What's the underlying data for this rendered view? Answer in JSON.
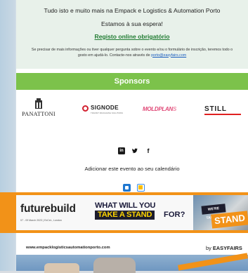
{
  "email": {
    "line1": "Tudo isto e muito mais na Empack e Logistics & Automation Porto",
    "line2": "Estamos à sua espera!",
    "register_link": "Registo online obrigatório",
    "contact_text": "Se precisar de mais informações ou tiver qualquer pergunta sobre o evento e/ou o formulário de inscrição, teremos todo o gosto em ajudá-lo. Contacte-nos através de",
    "contact_email": "porto@easyfairs.com"
  },
  "sponsors": {
    "title": "Sponsors",
    "items": [
      {
        "name": "PANATTONI"
      },
      {
        "name": "SIGNODE",
        "tagline": "TRANSIT PACKAGING SOLUTIONS"
      },
      {
        "name": "MOLDPLAN",
        "name_suffix": "S"
      },
      {
        "name": "STILL"
      }
    ]
  },
  "social": {
    "icons": [
      "linkedin-icon",
      "twitter-icon",
      "facebook-icon"
    ]
  },
  "calendar": {
    "text": "Adicionar este evento ao seu calendário",
    "icons": [
      "outlook-icon",
      "google-calendar-icon"
    ]
  },
  "banner": {
    "brand": "futurebuild",
    "date_text": "07 - 09 March 2023 | ExCeL, London",
    "headline_line1": "WHAT WILL YOU",
    "headline_highlight": "TAKE A STAND",
    "headline_end": "FOR?",
    "photo_sign_small": "WE'RE TAKING A",
    "photo_sign_big": "STAND",
    "accent_color": "#f29218"
  },
  "footer": {
    "url": "www.empacklogisticsautomationporto.com",
    "by_prefix": "by",
    "by_brand": "EASYFAIRS"
  }
}
